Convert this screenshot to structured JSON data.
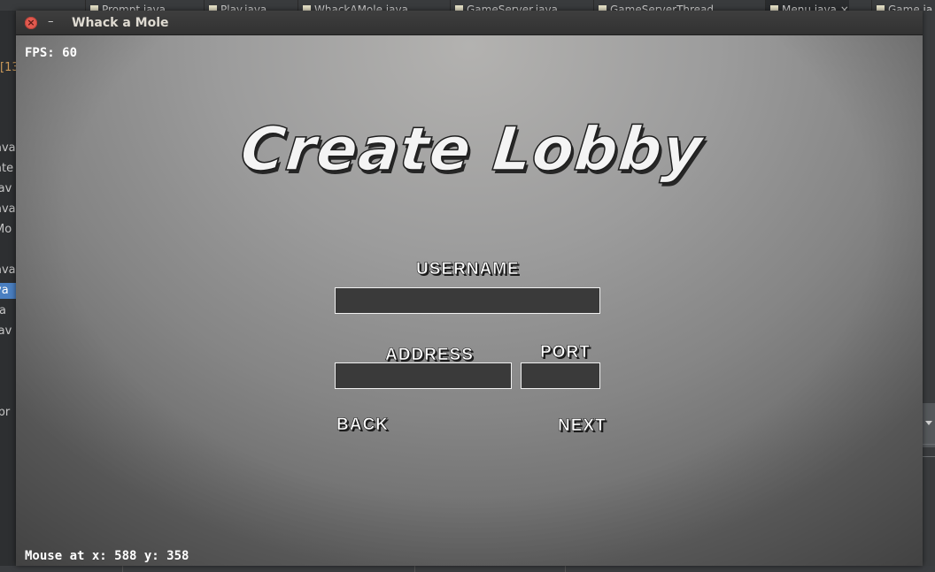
{
  "ide": {
    "tabs": [
      {
        "label": "Prompt.java",
        "active": false
      },
      {
        "label": "Play.java",
        "active": false
      },
      {
        "label": "WhackAMole.java",
        "active": false
      },
      {
        "label": "GameServer.java",
        "active": false
      },
      {
        "label": "GameServerThread",
        "active": false
      },
      {
        "label": "Menu.java ×",
        "active": true
      },
      {
        "label": "Game.ja",
        "active": false
      }
    ],
    "sidebar": {
      "bracket": "[13",
      "items": [
        "ava",
        "ate",
        "jav",
        "ava",
        "Mo",
        "ava",
        "va",
        "a",
        "jav",
        "ibr"
      ]
    }
  },
  "window": {
    "title": "Whack a Mole",
    "close_glyph": "×",
    "minimize_glyph": "–"
  },
  "game": {
    "fps": "FPS: 60",
    "heading": "Create Lobby",
    "username_label": "USERNAME",
    "address_label": "ADDRESS",
    "port_label": "PORT",
    "username_value": "",
    "address_value": "",
    "port_value": "",
    "back_label": "BACK",
    "next_label": "NEXT",
    "mouse_readout": "Mouse at x: 588 y: 358"
  }
}
